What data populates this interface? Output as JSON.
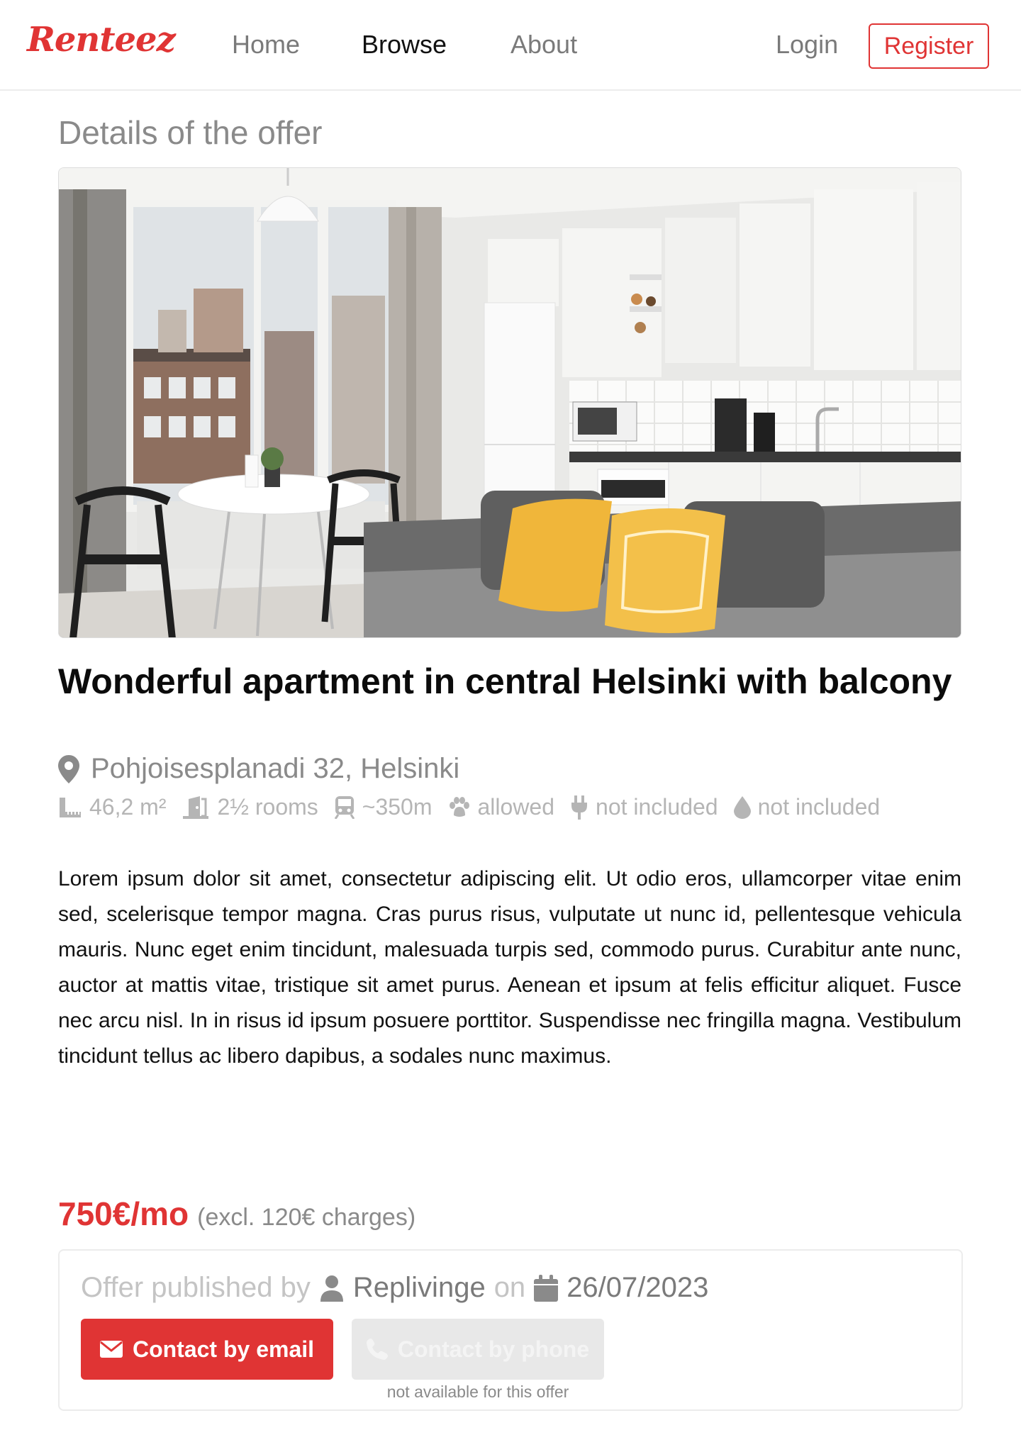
{
  "nav": {
    "logo": "Renteez",
    "home": "Home",
    "browse": "Browse",
    "about": "About",
    "login": "Login",
    "register": "Register"
  },
  "page_title": "Details of the offer",
  "photo": {
    "subject": "apartment-interior-photo"
  },
  "offer": {
    "title": "Wonderful apartment in central Helsinki with balcony",
    "address": "Pohjoisesplanadi 32, Helsinki",
    "features": {
      "area": "46,2 m²",
      "rooms": "2½ rooms",
      "transport": "~350m",
      "pets": "allowed",
      "electricity": "not included",
      "water": "not included"
    },
    "description": "Lorem ipsum dolor sit amet, consectetur adipiscing elit. Ut odio eros, ullamcorper vitae enim sed, scelerisque tempor magna. Cras purus risus, vulputate ut nunc id, pellentesque vehicula mauris. Nunc eget enim tincidunt, malesuada turpis sed, commodo purus. Curabitur ante nunc, auctor at mattis vitae, tristique sit amet purus. Aenean et ipsum at felis efficitur aliquet. Fusce nec arcu nisl. In in risus id ipsum posuere porttitor. Suspendisse nec fringilla magna. Vestibulum tincidunt tellus ac libero dapibus, a sodales nunc maximus.",
    "price": "750€/mo",
    "charges": "(excl. 120€ charges)"
  },
  "publish": {
    "prefix": "Offer published by",
    "author": "Replivinge",
    "on": "on",
    "date": "26/07/2023",
    "email_button": "Contact by email",
    "phone_button": "Contact by phone",
    "phone_note": "not available for this offer"
  },
  "colors": {
    "accent": "#e03434",
    "muted_text": "#8a8a8a",
    "light_text": "#b5b5b5"
  }
}
